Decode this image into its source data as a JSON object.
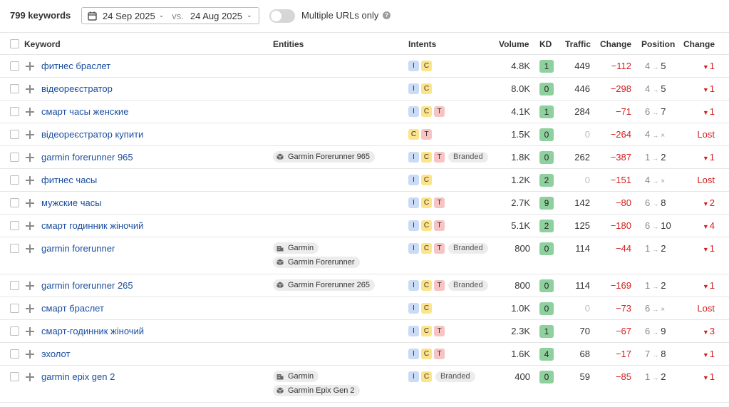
{
  "toolbar": {
    "keyword_count": "799 keywords",
    "date_current": "24 Sep 2025",
    "vs_label": "vs.",
    "date_compare": "24 Aug 2025",
    "multiple_urls_label": "Multiple URLs only",
    "multiple_urls_enabled": false
  },
  "table": {
    "headers": {
      "keyword": "Keyword",
      "entities": "Entities",
      "intents": "Intents",
      "volume": "Volume",
      "kd": "KD",
      "traffic": "Traffic",
      "change": "Change",
      "position": "Position",
      "position_change": "Change"
    },
    "rows": [
      {
        "keyword": "фитнес браслет",
        "entities": [],
        "intents": [
          "I",
          "C"
        ],
        "branded": "",
        "volume": "4.8K",
        "kd": "1",
        "traffic": "449",
        "change": "−112",
        "pos_from": "4",
        "pos_to": "5",
        "pos_change": "1",
        "lost": false
      },
      {
        "keyword": "відеореєстратор",
        "entities": [],
        "intents": [
          "I",
          "C"
        ],
        "branded": "",
        "volume": "8.0K",
        "kd": "0",
        "traffic": "446",
        "change": "−298",
        "pos_from": "4",
        "pos_to": "5",
        "pos_change": "1",
        "lost": false
      },
      {
        "keyword": "смарт часы женские",
        "entities": [],
        "intents": [
          "I",
          "C",
          "T"
        ],
        "branded": "",
        "volume": "4.1K",
        "kd": "1",
        "traffic": "284",
        "change": "−71",
        "pos_from": "6",
        "pos_to": "7",
        "pos_change": "1",
        "lost": false
      },
      {
        "keyword": "відеореєстратор купити",
        "entities": [],
        "intents": [
          "C",
          "T"
        ],
        "branded": "",
        "volume": "1.5K",
        "kd": "0",
        "traffic": "0",
        "change": "−264",
        "pos_from": "4",
        "pos_to": "×",
        "pos_change": "Lost",
        "lost": true
      },
      {
        "keyword": "garmin forerunner 965",
        "entities": [
          {
            "type": "product",
            "label": "Garmin Forerunner 965"
          }
        ],
        "intents": [
          "I",
          "C",
          "T"
        ],
        "branded": "Branded",
        "volume": "1.8K",
        "kd": "0",
        "traffic": "262",
        "change": "−387",
        "pos_from": "1",
        "pos_to": "2",
        "pos_change": "1",
        "lost": false
      },
      {
        "keyword": "фитнес часы",
        "entities": [],
        "intents": [
          "I",
          "C"
        ],
        "branded": "",
        "volume": "1.2K",
        "kd": "2",
        "traffic": "0",
        "change": "−151",
        "pos_from": "4",
        "pos_to": "×",
        "pos_change": "Lost",
        "lost": true
      },
      {
        "keyword": "мужские часы",
        "entities": [],
        "intents": [
          "I",
          "C",
          "T"
        ],
        "branded": "",
        "volume": "2.7K",
        "kd": "9",
        "traffic": "142",
        "change": "−80",
        "pos_from": "6",
        "pos_to": "8",
        "pos_change": "2",
        "lost": false
      },
      {
        "keyword": "смарт годинник жіночий",
        "entities": [],
        "intents": [
          "I",
          "C",
          "T"
        ],
        "branded": "",
        "volume": "5.1K",
        "kd": "2",
        "traffic": "125",
        "change": "−180",
        "pos_from": "6",
        "pos_to": "10",
        "pos_change": "4",
        "lost": false
      },
      {
        "keyword": "garmin forerunner",
        "entities": [
          {
            "type": "company",
            "label": "Garmin"
          },
          {
            "type": "product",
            "label": "Garmin Forerunner"
          }
        ],
        "intents": [
          "I",
          "C",
          "T"
        ],
        "branded": "Branded",
        "volume": "800",
        "kd": "0",
        "traffic": "114",
        "change": "−44",
        "pos_from": "1",
        "pos_to": "2",
        "pos_change": "1",
        "lost": false
      },
      {
        "keyword": "garmin forerunner 265",
        "entities": [
          {
            "type": "product",
            "label": "Garmin Forerunner 265"
          }
        ],
        "intents": [
          "I",
          "C",
          "T"
        ],
        "branded": "Branded",
        "volume": "800",
        "kd": "0",
        "traffic": "114",
        "change": "−169",
        "pos_from": "1",
        "pos_to": "2",
        "pos_change": "1",
        "lost": false
      },
      {
        "keyword": "смарт браслет",
        "entities": [],
        "intents": [
          "I",
          "C"
        ],
        "branded": "",
        "volume": "1.0K",
        "kd": "0",
        "traffic": "0",
        "change": "−73",
        "pos_from": "6",
        "pos_to": "×",
        "pos_change": "Lost",
        "lost": true
      },
      {
        "keyword": "смарт-годинник жіночий",
        "entities": [],
        "intents": [
          "I",
          "C",
          "T"
        ],
        "branded": "",
        "volume": "2.3K",
        "kd": "1",
        "traffic": "70",
        "change": "−67",
        "pos_from": "6",
        "pos_to": "9",
        "pos_change": "3",
        "lost": false
      },
      {
        "keyword": "эхолот",
        "entities": [],
        "intents": [
          "I",
          "C",
          "T"
        ],
        "branded": "",
        "volume": "1.6K",
        "kd": "4",
        "traffic": "68",
        "change": "−17",
        "pos_from": "7",
        "pos_to": "8",
        "pos_change": "1",
        "lost": false
      },
      {
        "keyword": "garmin epix gen 2",
        "entities": [
          {
            "type": "company",
            "label": "Garmin"
          },
          {
            "type": "product",
            "label": "Garmin Epix Gen 2"
          }
        ],
        "intents": [
          "I",
          "C"
        ],
        "branded": "Branded",
        "volume": "400",
        "kd": "0",
        "traffic": "59",
        "change": "−85",
        "pos_from": "1",
        "pos_to": "2",
        "pos_change": "1",
        "lost": false
      }
    ]
  },
  "colors": {
    "link": "#1b4ea0",
    "negative": "#d32020",
    "kd_easy": "#8fd19e",
    "intent_informational": "#c9dbf5",
    "intent_commercial": "#fbe48b",
    "intent_transactional": "#f7c4c4"
  }
}
